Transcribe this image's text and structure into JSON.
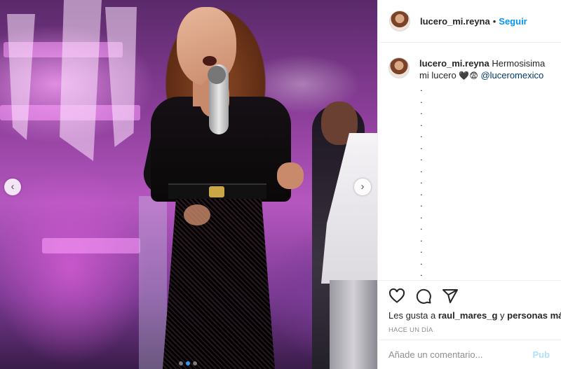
{
  "post": {
    "username": "lucero_mi.reyna",
    "separator": "•",
    "follow_label": "Seguir",
    "photo_alt": "Singer performing on stage in black outfit holding a microphone",
    "carousel": {
      "total": 3,
      "active": 2
    }
  },
  "caption": {
    "username": "lucero_mi.reyna",
    "text": "Hermosisima mi lucero",
    "emojis": "🖤😨",
    "mention": "@luceromexico",
    "dot_lines": [
      ".",
      ".",
      ".",
      ".",
      ".",
      ".",
      ".",
      ".",
      ".",
      ".",
      ".",
      ".",
      ".",
      ".",
      ".",
      ".",
      "."
    ]
  },
  "actions": {
    "like_icon": "heart-icon",
    "comment_icon": "comment-icon",
    "share_icon": "share-icon"
  },
  "likes": {
    "prefix": "Les gusta a",
    "user": "raul_mares_g",
    "middle": "y",
    "suffix": "personas más"
  },
  "timestamp": "HACE UN DÍA",
  "comment": {
    "placeholder": "Añade un comentario...",
    "publish_label": "Pub"
  },
  "colors": {
    "accent": "#0095f6",
    "publish_disabled": "#b2dffc",
    "meta_gray": "#8e8e8e",
    "mention": "#00376b"
  }
}
